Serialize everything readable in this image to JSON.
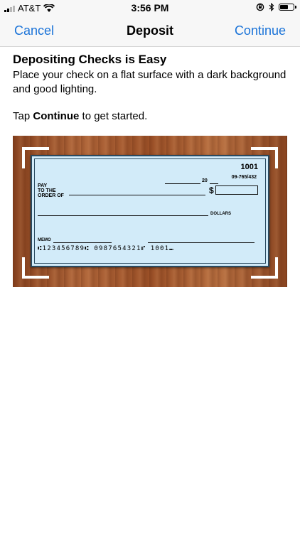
{
  "status_bar": {
    "carrier": "AT&T",
    "time": "3:56 PM"
  },
  "nav": {
    "cancel_label": "Cancel",
    "title": "Deposit",
    "continue_label": "Continue"
  },
  "intro": {
    "heading": "Depositing Checks is Easy",
    "description": "Place your check on a flat surface with a dark background and good lighting.",
    "tap_prefix": "Tap ",
    "tap_bold": "Continue",
    "tap_suffix": " to get started."
  },
  "check": {
    "number": "1001",
    "routing_fraction": "09-765/432",
    "date_suffix": "20",
    "pay_line1": "PAY",
    "pay_line2": "TO THE",
    "pay_line3": "ORDER OF",
    "dollar_sign": "$",
    "dollars_label": "DOLLARS",
    "memo_label": "MEMO",
    "micr_line": "⑆123456789⑆  0987654321⑈  1001⑉"
  },
  "colors": {
    "accent": "#1a73d8",
    "check_paper": "#d2ebf9",
    "wood": "#a35a30"
  }
}
